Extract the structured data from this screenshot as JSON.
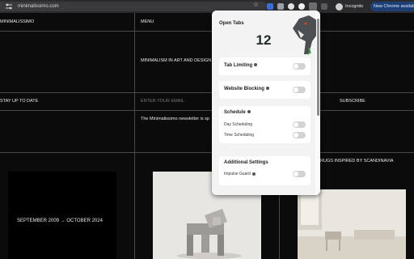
{
  "browser": {
    "url": "minimalissimo.com",
    "incognito_label": "Incognito",
    "new_chrome_label": "New Chrome available"
  },
  "site": {
    "brand": "MINIMALISSIMO",
    "menu": "MENU",
    "tagline": "MINIMALISM IN ART AND DESIGN",
    "stay_up_to_date": "STAY UP TO DATE",
    "email_placeholder": "ENTER YOUR EMAIL",
    "subscribe": "SUBSCRIBE",
    "newsletter_text": "The Minimalissimo newsletter is sp",
    "date_range": "SEPTEMBER 2009 → OCTOBER 2024",
    "article_caption": "RUGS INSPIRED BY SCANDINAVIA"
  },
  "popup": {
    "title": "Open Tabs",
    "tab_count": "12",
    "tab_limiting": "Tab Limiting",
    "website_blocking": "Website Blocking",
    "schedule": "Schedule",
    "day_scheduling": "Day Scheduling",
    "time_scheduling": "Time Scheduling",
    "additional_settings": "Additional Settings",
    "impulse_guard": "Impulse Guard",
    "toggles": {
      "tab_limiting": false,
      "website_blocking": false,
      "day_scheduling": false,
      "time_scheduling": false,
      "impulse_guard": false
    }
  },
  "icons": [
    "tune-icon",
    "star-icon",
    "extension-icon",
    "incognito-icon",
    "dinosaur-mascot-icon",
    "info-icon"
  ],
  "colors": {
    "toolbar": "#2b2b2e",
    "page_bg": "#0b0b0b",
    "new_chrome_btn": "#1d3f73",
    "popup_bg": "#f3f3f3",
    "toggle_off": "#d2d2d2"
  }
}
